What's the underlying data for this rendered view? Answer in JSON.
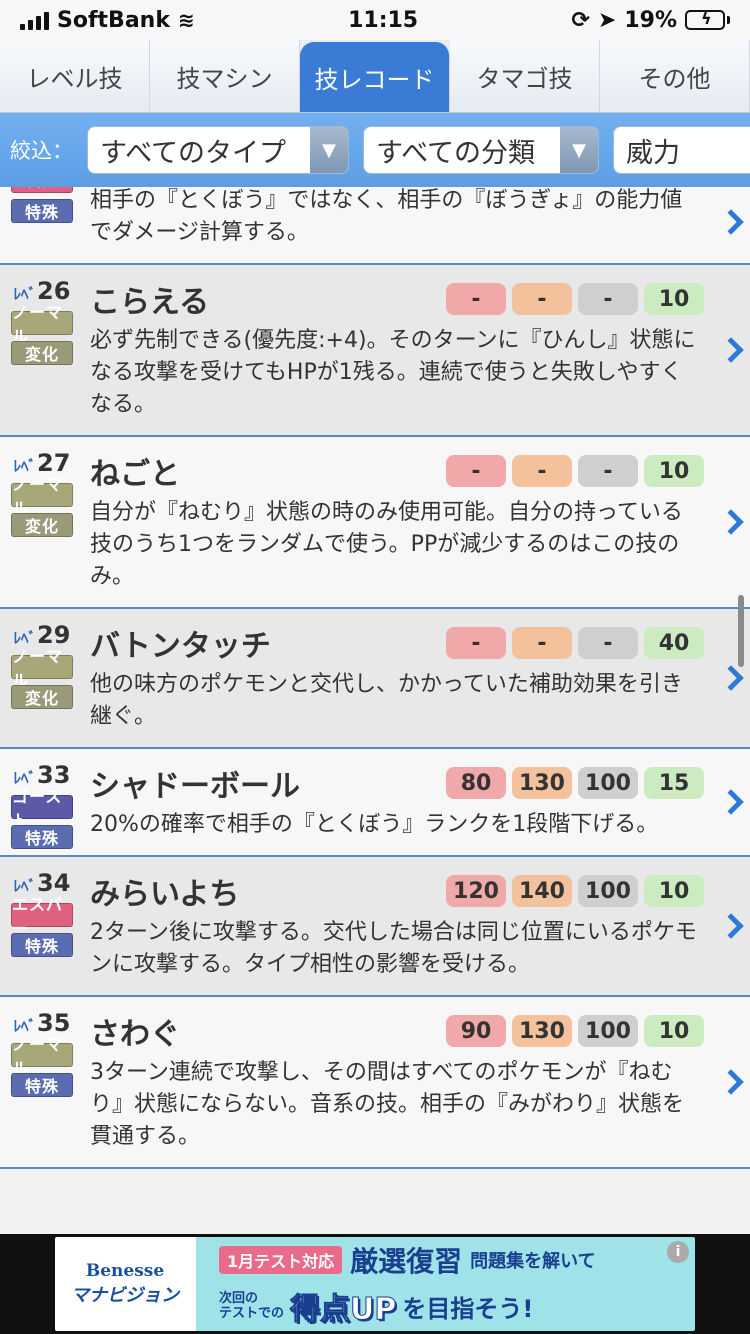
{
  "status": {
    "carrier": "SoftBank",
    "time": "11:15",
    "battery": "19%",
    "battery_level": 0.19
  },
  "tabs": [
    {
      "label": "レベル技",
      "active": false
    },
    {
      "label": "技マシン",
      "active": false
    },
    {
      "label": "技レコード",
      "active": true
    },
    {
      "label": "タマゴ技",
      "active": false
    },
    {
      "label": "その他",
      "active": false
    }
  ],
  "filter": {
    "label": "絞込：",
    "type_select": "すべてのタイプ",
    "category_select": "すべての分類",
    "power_select": "威力"
  },
  "level_prefix": "ﾚﾍﾞ",
  "moves": [
    {
      "level": "",
      "name": "",
      "type": "エスパー",
      "type_class": "t-psychic",
      "category": "特殊",
      "category_class": "c-special",
      "stats": [],
      "desc": "相手の『とくぼう』ではなく、相手の『ぼうぎょ』の能力値でダメージ計算する。",
      "partial": true
    },
    {
      "level": "26",
      "name": "こらえる",
      "type": "ノーマル",
      "type_class": "t-normal",
      "category": "変化",
      "category_class": "c-status",
      "stats": [
        "-",
        "-",
        "-",
        "10"
      ],
      "desc": "必ず先制できる(優先度:+4)。そのターンに『ひんし』状態になる攻撃を受けてもHPが1残る。連続で使うと失敗しやすくなる。"
    },
    {
      "level": "27",
      "name": "ねごと",
      "type": "ノーマル",
      "type_class": "t-normal",
      "category": "変化",
      "category_class": "c-status",
      "stats": [
        "-",
        "-",
        "-",
        "10"
      ],
      "desc": "自分が『ねむり』状態の時のみ使用可能。自分の持っている技のうち1つをランダムで使う。PPが減少するのはこの技のみ。"
    },
    {
      "level": "29",
      "name": "バトンタッチ",
      "type": "ノーマル",
      "type_class": "t-normal",
      "category": "変化",
      "category_class": "c-status",
      "stats": [
        "-",
        "-",
        "-",
        "40"
      ],
      "desc": "他の味方のポケモンと交代し、かかっていた補助効果を引き継ぐ。"
    },
    {
      "level": "33",
      "name": "シャドーボール",
      "type": "ゴースト",
      "type_class": "t-ghost",
      "category": "特殊",
      "category_class": "c-special",
      "stats": [
        "80",
        "130",
        "100",
        "15"
      ],
      "desc": "20%の確率で相手の『とくぼう』ランクを1段階下げる。"
    },
    {
      "level": "34",
      "name": "みらいよち",
      "type": "エスパー",
      "type_class": "t-psychic",
      "category": "特殊",
      "category_class": "c-special",
      "stats": [
        "120",
        "140",
        "100",
        "10"
      ],
      "desc": "2ターン後に攻撃する。交代した場合は同じ位置にいるポケモンに攻撃する。タイプ相性の影響を受ける。"
    },
    {
      "level": "35",
      "name": "さわぐ",
      "type": "ノーマル",
      "type_class": "t-normal",
      "category": "特殊",
      "category_class": "c-special",
      "stats": [
        "90",
        "130",
        "100",
        "10"
      ],
      "desc": "3ターン連続で攻撃し、その間はすべてのポケモンが『ねむり』状態にならない。音系の技。相手の『みがわり』状態を貫通する。"
    }
  ],
  "ad": {
    "brand_top": "Benesse",
    "brand_bottom": "マナビジョン",
    "tag": "1月テスト対応",
    "headline": "厳選復習",
    "headline_suffix": "問題集を解いて",
    "small_line1": "次回の",
    "small_line2": "テストでの",
    "headline2": "得点UP",
    "headline2_suffix": "を目指そう!",
    "info": "i"
  }
}
